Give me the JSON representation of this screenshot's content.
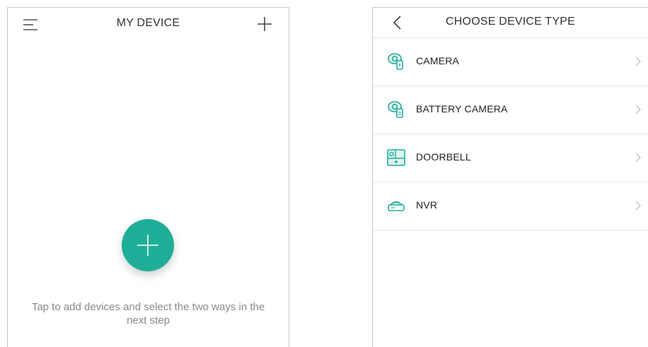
{
  "left_screen": {
    "title": "MY DEVICE",
    "menu_icon": "hamburger-menu-icon",
    "add_icon": "plus-icon",
    "fab_icon": "plus-icon",
    "hint": "Tap to add devices and select the two ways in the next step"
  },
  "right_screen": {
    "title": "CHOOSE DEVICE TYPE",
    "back_icon": "chevron-left-icon",
    "items": [
      {
        "label": "CAMERA",
        "icon": "camera-icon"
      },
      {
        "label": "BATTERY CAMERA",
        "icon": "battery-camera-icon"
      },
      {
        "label": "DOORBELL",
        "icon": "doorbell-icon"
      },
      {
        "label": "NVR",
        "icon": "nvr-icon"
      }
    ]
  },
  "colors": {
    "accent": "#1fae98",
    "text_dark": "#333333",
    "text_muted": "#8a8a8a",
    "divider": "#e6e6e6"
  }
}
